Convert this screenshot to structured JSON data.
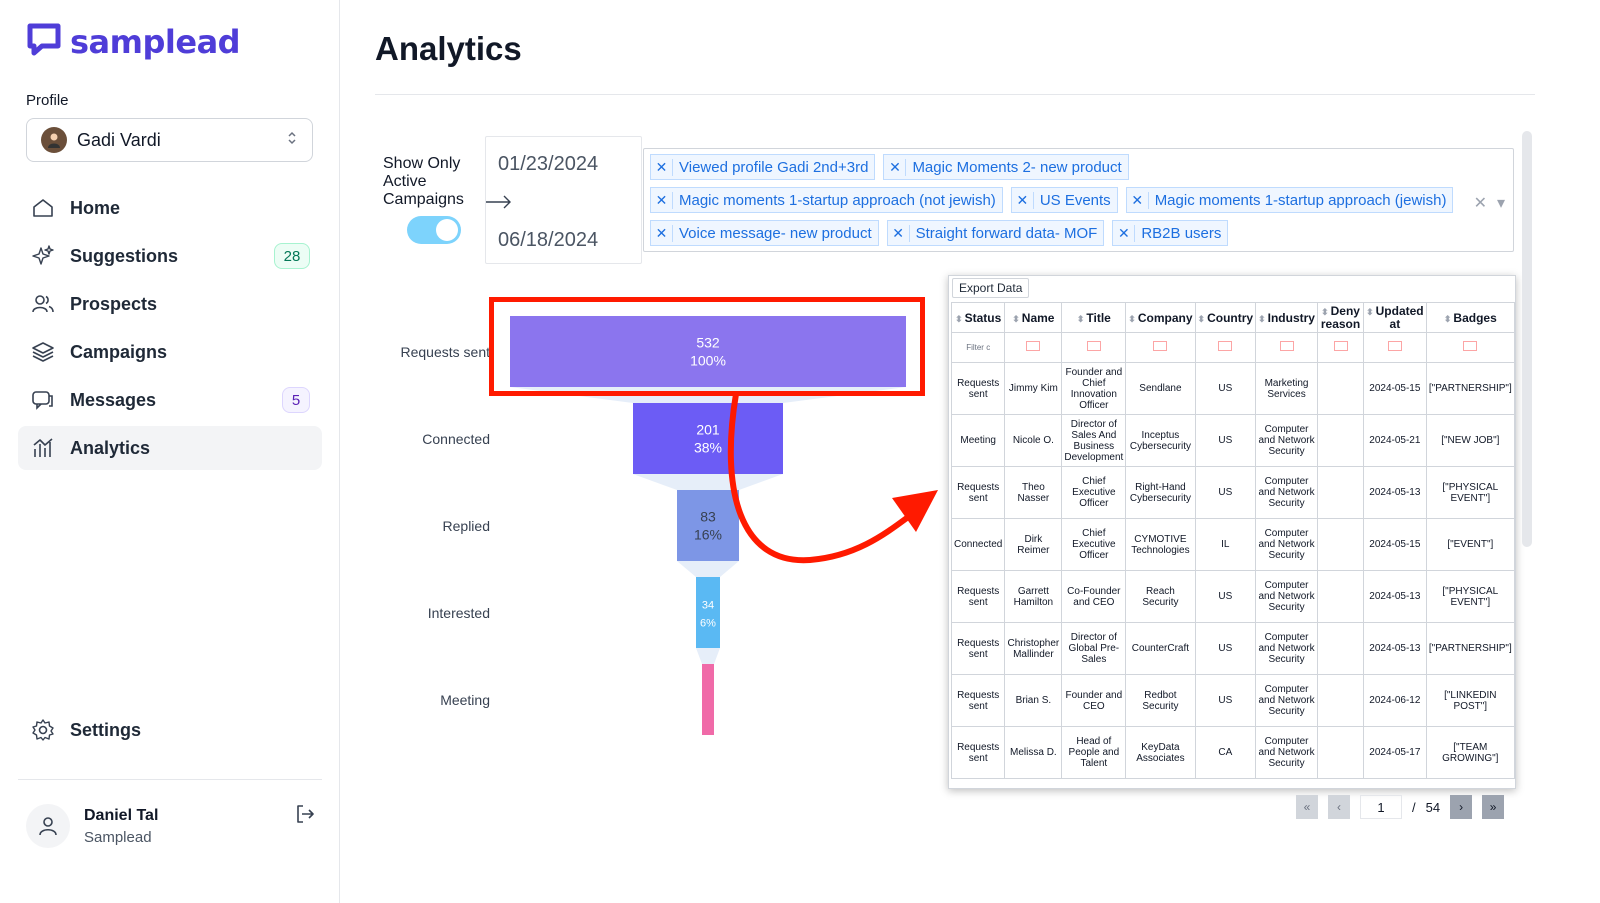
{
  "app": {
    "name": "samplead"
  },
  "profile": {
    "label": "Profile",
    "name": "Gadi Vardi"
  },
  "nav": [
    {
      "label": "Home",
      "icon": "home-icon"
    },
    {
      "label": "Suggestions",
      "icon": "sparkles-icon",
      "badge": "28"
    },
    {
      "label": "Prospects",
      "icon": "users-icon"
    },
    {
      "label": "Campaigns",
      "icon": "layers-icon"
    },
    {
      "label": "Messages",
      "icon": "chat-icon",
      "badge": "5"
    },
    {
      "label": "Analytics",
      "icon": "analytics-icon",
      "active": true
    }
  ],
  "settings": {
    "label": "Settings"
  },
  "user": {
    "name": "Daniel Tal",
    "org": "Samplead"
  },
  "page": {
    "title": "Analytics"
  },
  "filters": {
    "active_label": "Show Only Active Campaigns",
    "active_on": true,
    "date_start": "01/23/2024",
    "date_end": "06/18/2024",
    "campaigns": [
      [
        "Viewed profile Gadi 2nd+3rd",
        "Magic Moments 2- new product"
      ],
      [
        "Magic moments 1-startup approach (not jewish)",
        "US Events",
        "Magic moments 1-startup approach (jewish)"
      ],
      [
        "Voice message- new product",
        "Straight forward data- MOF",
        "RB2B users"
      ]
    ]
  },
  "chart_data": {
    "type": "funnel",
    "categories": [
      "Requests sent",
      "Connected",
      "Replied",
      "Interested",
      "Meeting"
    ],
    "values": [
      532,
      201,
      83,
      34,
      null
    ],
    "percent_labels": [
      "100%",
      "38%",
      "16%",
      "6%",
      ""
    ],
    "colors": [
      "#8b75ee",
      "#6c5cf5",
      "#7d96e6",
      "#5ab9f3",
      "#f06aa8"
    ]
  },
  "export": {
    "button": "Export Data",
    "filter_placeholder": "Filter c",
    "columns": [
      "Status",
      "Name",
      "Title",
      "Company",
      "Country",
      "Industry",
      "Deny reason",
      "Updated at",
      "Badges"
    ],
    "rows": [
      [
        "Requests sent",
        "Jimmy Kim",
        "Founder and Chief Innovation Officer",
        "Sendlane",
        "US",
        "Marketing Services",
        "",
        "2024-05-15",
        "[\"PARTNERSHIP\"]"
      ],
      [
        "Meeting",
        "Nicole O.",
        "Director of Sales And Business Development",
        "Inceptus Cybersecurity",
        "US",
        "Computer and Network Security",
        "",
        "2024-05-21",
        "[\"NEW JOB\"]"
      ],
      [
        "Requests sent",
        "Theo Nasser",
        "Chief Executive Officer",
        "Right-Hand Cybersecurity",
        "US",
        "Computer and Network Security",
        "",
        "2024-05-13",
        "[\"PHYSICAL EVENT\"]"
      ],
      [
        "Connected",
        "Dirk Reimer",
        "Chief Executive Officer",
        "CYMOTIVE Technologies",
        "IL",
        "Computer and Network Security",
        "",
        "2024-05-15",
        "[\"EVENT\"]"
      ],
      [
        "Requests sent",
        "Garrett Hamilton",
        "Co-Founder and CEO",
        "Reach Security",
        "US",
        "Computer and Network Security",
        "",
        "2024-05-13",
        "[\"PHYSICAL EVENT\"]"
      ],
      [
        "Requests sent",
        "Christopher Mallinder",
        "Director of Global Pre-Sales",
        "CounterCraft",
        "US",
        "Computer and Network Security",
        "",
        "2024-05-13",
        "[\"PARTNERSHIP\"]"
      ],
      [
        "Requests sent",
        "Brian S.",
        "Founder and CEO",
        "Redbot Security",
        "US",
        "Computer and Network Security",
        "",
        "2024-06-12",
        "[\"LINKEDIN POST\"]"
      ],
      [
        "Requests sent",
        "Melissa D.",
        "Head of People and Talent",
        "KeyData Associates",
        "CA",
        "Computer and Network Security",
        "",
        "2024-05-17",
        "[\"TEAM GROWING\"]"
      ]
    ]
  },
  "pagination": {
    "current": "1",
    "separator": "/",
    "total": "54"
  }
}
